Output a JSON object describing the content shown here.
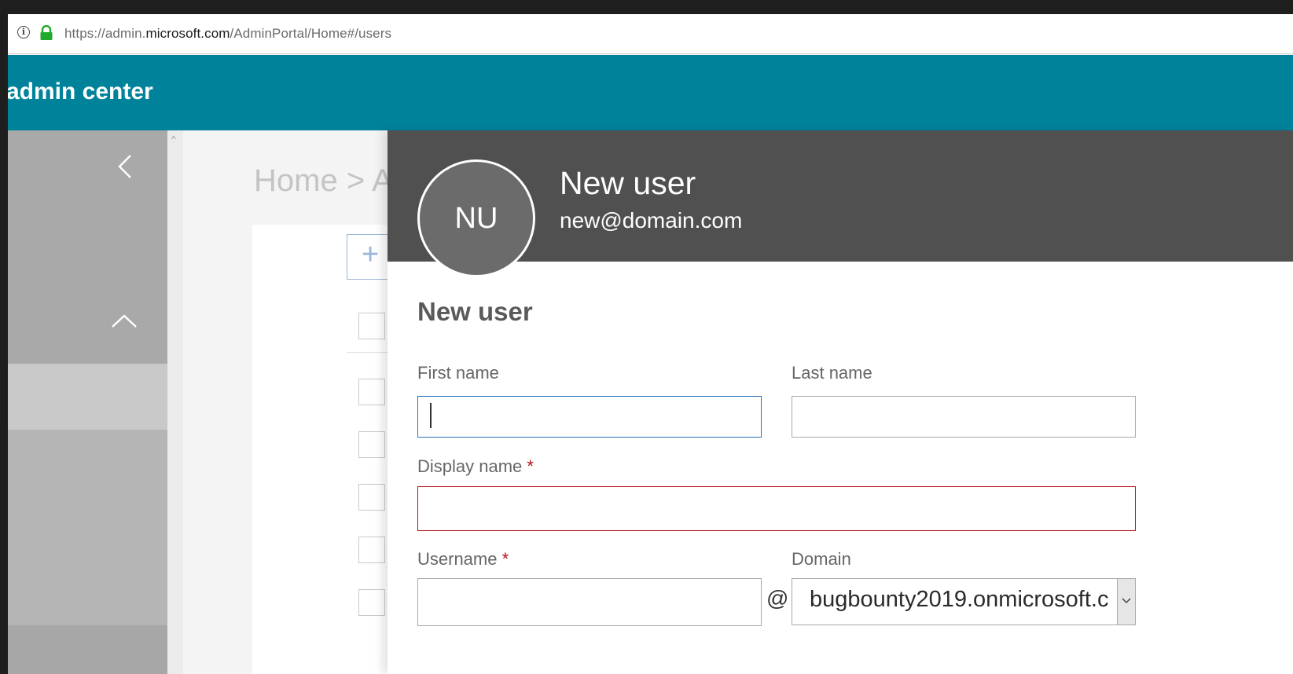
{
  "browser": {
    "url_prefix": "https://admin.",
    "url_host": "microsoft.com",
    "url_path": "/AdminPortal/Home#/users"
  },
  "header": {
    "title": "admin center"
  },
  "background_page": {
    "breadcrumb": "Home > Ac"
  },
  "panel": {
    "avatar_initials": "NU",
    "header_title": "New user",
    "header_subtitle": "new@domain.com",
    "form_title": "New user",
    "fields": {
      "first_name": {
        "label": "First name",
        "value": ""
      },
      "last_name": {
        "label": "Last name",
        "value": ""
      },
      "display_name": {
        "label": "Display name",
        "required_marker": "*",
        "value": ""
      },
      "username": {
        "label": "Username",
        "required_marker": "*",
        "value": ""
      },
      "at_symbol": "@",
      "domain": {
        "label": "Domain",
        "value": "bugbounty2019.onmicrosoft.c"
      }
    }
  },
  "colors": {
    "header": "#00829b",
    "panel_header": "#505050",
    "focus_border": "#2b73b6",
    "error_border": "#b3121b"
  }
}
